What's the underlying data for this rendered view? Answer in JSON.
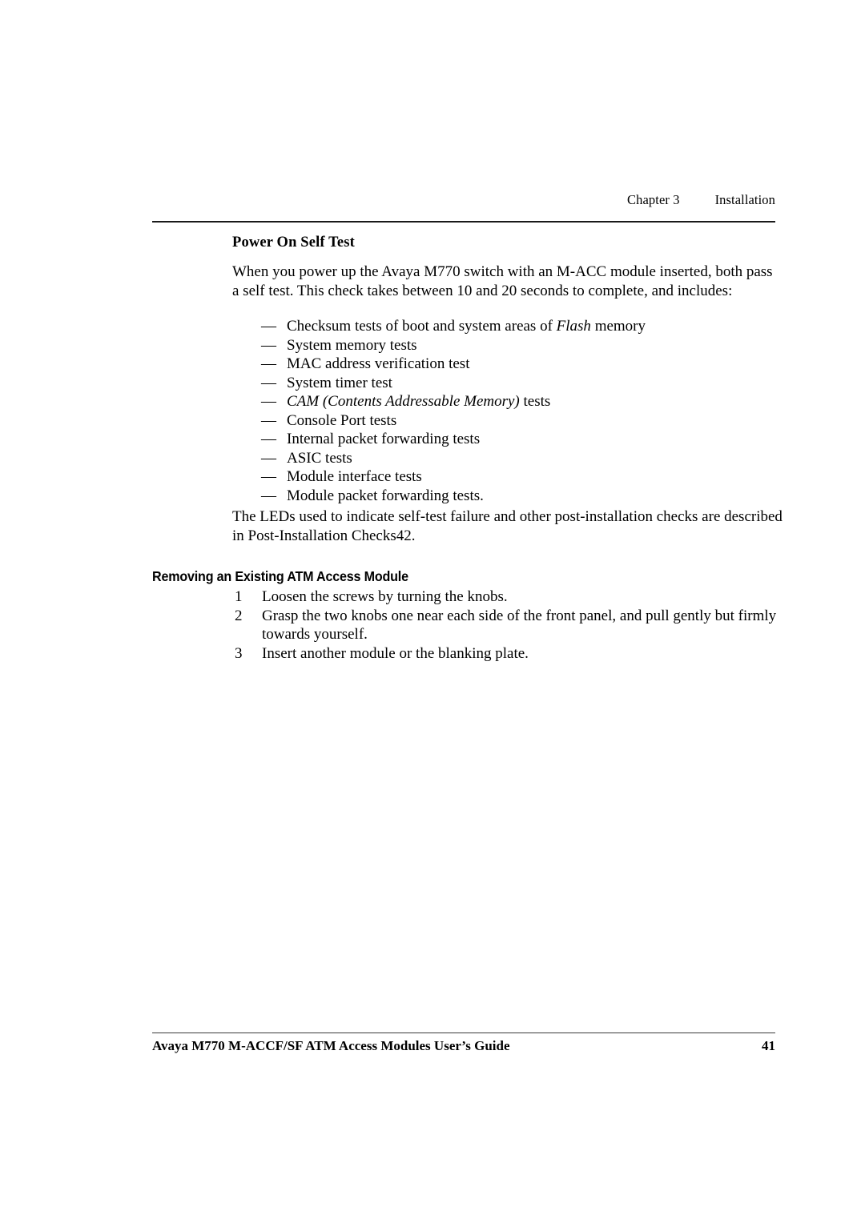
{
  "document": {
    "header": {
      "chapter_label": "Chapter 3",
      "chapter_title": "Installation"
    },
    "sub_heading": "Power On Self Test",
    "intro_paragraph": "When you power up the Avaya M770 switch with an M-ACC module inserted, both pass a self test. This check takes between 10 and 20 seconds to complete, and includes:",
    "dash_list": [
      {
        "dash": "—",
        "text_pre": "Checksum tests of boot and system areas of ",
        "text_italic": "Flash",
        "text_post": " memory"
      },
      {
        "dash": "—",
        "text_pre": "System memory tests",
        "text_italic": "",
        "text_post": ""
      },
      {
        "dash": "—",
        "text_pre": "MAC address verification test",
        "text_italic": "",
        "text_post": ""
      },
      {
        "dash": "—",
        "text_pre": "System timer test",
        "text_italic": "",
        "text_post": ""
      },
      {
        "dash": "—",
        "text_pre": "",
        "text_italic": "CAM (Contents Addressable Memory)",
        "text_post": " tests"
      },
      {
        "dash": "—",
        "text_pre": "Console Port tests",
        "text_italic": "",
        "text_post": ""
      },
      {
        "dash": "—",
        "text_pre": "Internal packet forwarding tests",
        "text_italic": "",
        "text_post": ""
      },
      {
        "dash": "—",
        "text_pre": "ASIC tests",
        "text_italic": "",
        "text_post": ""
      },
      {
        "dash": "—",
        "text_pre": "Module interface tests",
        "text_italic": "",
        "text_post": ""
      },
      {
        "dash": "—",
        "text_pre": "Module packet forwarding tests.",
        "text_italic": "",
        "text_post": ""
      }
    ],
    "leds_paragraph": "The LEDs used to indicate self-test failure and other post-installation checks are described in Post-Installation Checks42.",
    "section_heading": "Removing an Existing ATM Access Module",
    "numbered_list": [
      {
        "number": "1",
        "text": "Loosen the screws by turning the knobs."
      },
      {
        "number": "2",
        "text": "Grasp the two knobs one near each side of the front panel, and pull gently but firmly towards yourself."
      },
      {
        "number": "3",
        "text": "Insert another module or the blanking plate."
      }
    ],
    "footer": {
      "title": "Avaya M770 M-ACCF/SF ATM Access Modules User’s Guide",
      "page_number": "41"
    }
  }
}
